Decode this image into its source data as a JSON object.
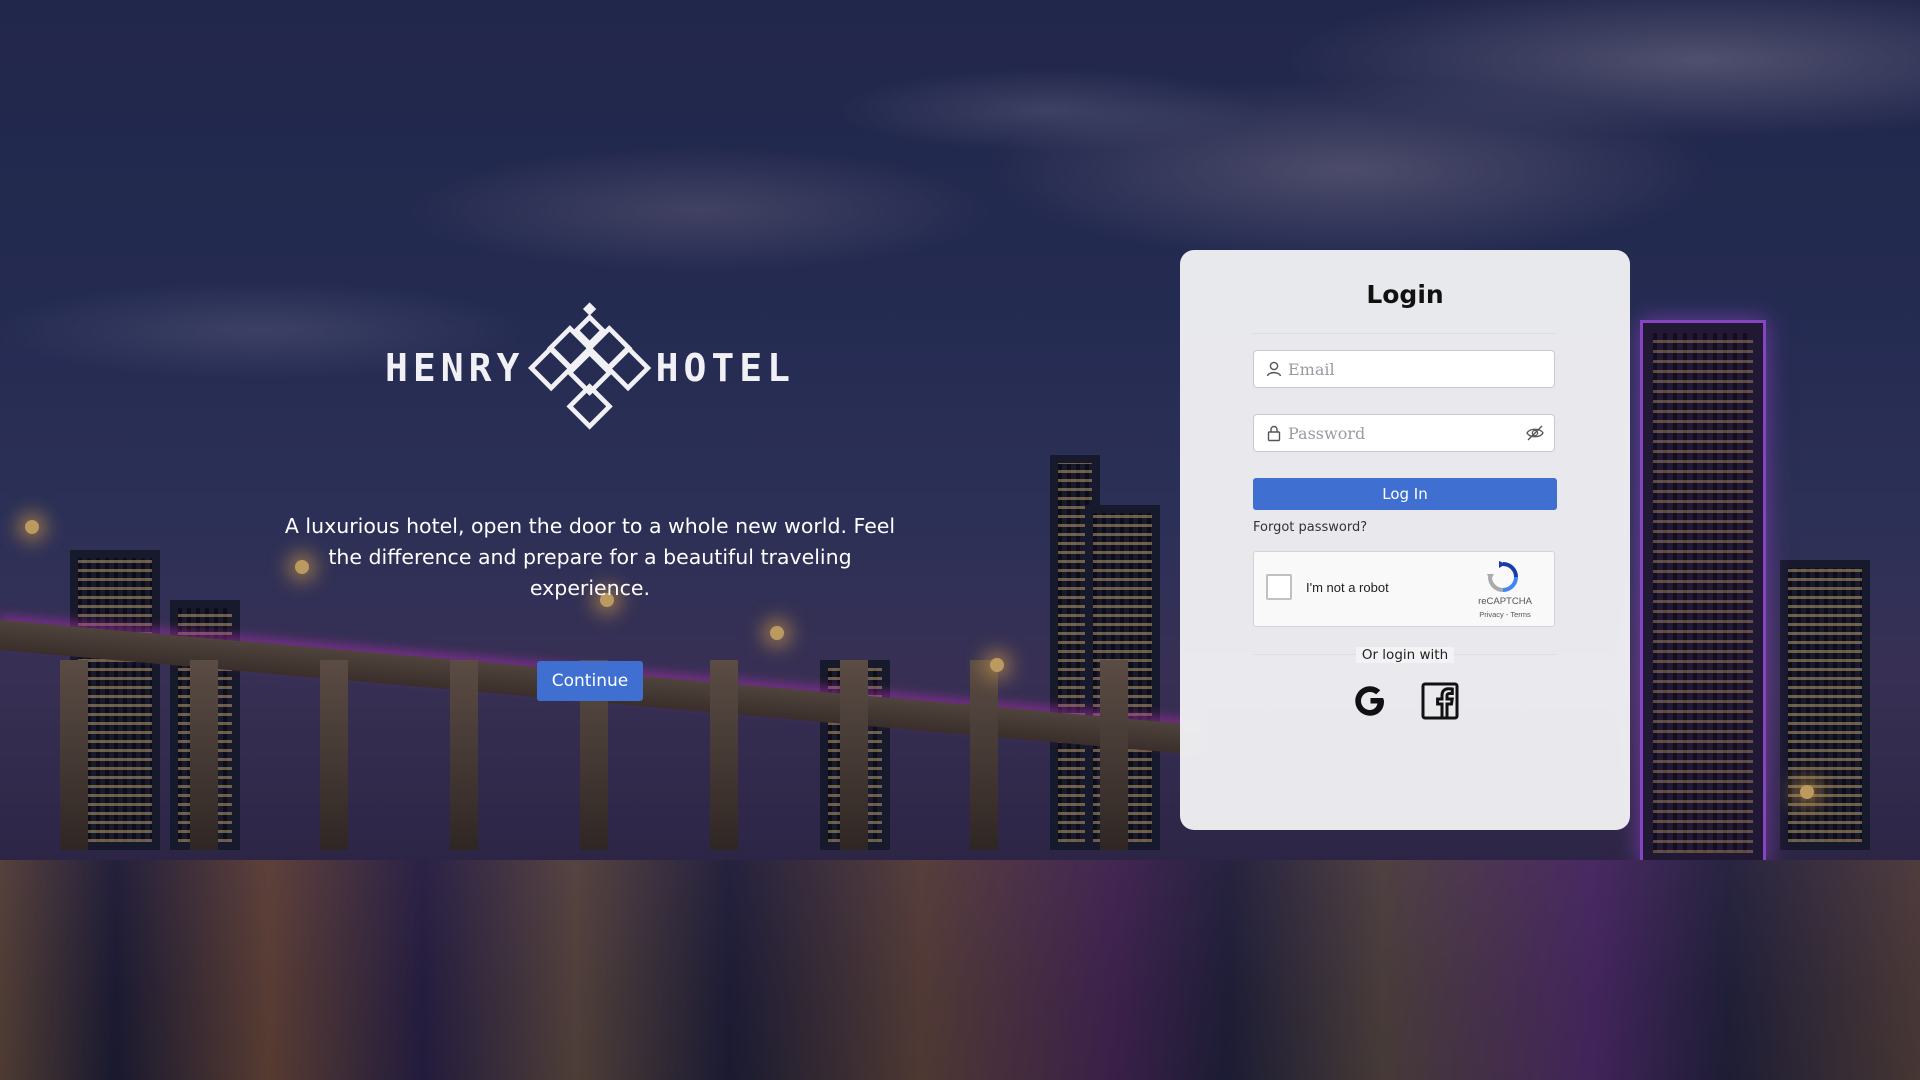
{
  "brand": {
    "name_left": "HENRY",
    "name_right": "HOTEL"
  },
  "hero": {
    "tagline": "A luxurious hotel, open the door to a whole new world. Feel the difference and prepare for a beautiful traveling experience.",
    "continue_label": "Continue"
  },
  "login": {
    "title": "Login",
    "email_placeholder": "Email",
    "password_placeholder": "Password",
    "submit_label": "Log In",
    "forgot_label": "Forgot password?",
    "or_login_with": "Or login with"
  },
  "captcha": {
    "label": "I'm not a robot",
    "brand": "reCAPTCHA",
    "links": "Privacy - Terms"
  },
  "social": {
    "google_icon": "google-icon",
    "facebook_icon": "facebook-icon"
  },
  "colors": {
    "accent": "#3f6fd0",
    "card_background": "#f3f3f6"
  },
  "icons": [
    "user-icon",
    "lock-icon",
    "eye-slash-icon",
    "recaptcha-icon",
    "google-icon",
    "facebook-icon",
    "hotel-logo-diamond-icon"
  ]
}
